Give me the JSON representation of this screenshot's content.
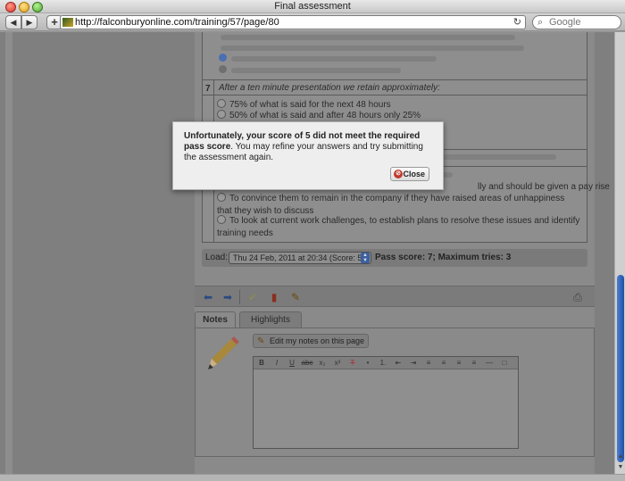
{
  "window": {
    "title": "Final assessment"
  },
  "toolbar": {
    "back_icon": "back-arrow-icon",
    "forward_icon": "forward-arrow-icon",
    "add_label": "+",
    "url": "http://falconburyonline.com/training/57/page/80",
    "reload_icon": "reload-icon",
    "search_placeholder": "Google"
  },
  "questions": {
    "q7": {
      "number": "7",
      "text": "After a ten minute presentation we retain approximately:",
      "options": [
        "75% of what is said for the next 48 hours",
        "50% of what is said and after 48 hours only 25%"
      ]
    },
    "q8": {
      "options": [
        "lly and should be given a pay rise",
        "To convince them to remain in the company if they have raised areas of unhappiness that they wish to discuss",
        "To look at current work challenges, to establish plans to resolve these issues and identify training needs"
      ]
    }
  },
  "load": {
    "label": "Load:",
    "selected": "Thu 24 Feb, 2011 at 20:34 (Score: 5)",
    "info": "Pass score: 7; Maximum tries: 3"
  },
  "tabs": {
    "notes": "Notes",
    "highlights": "Highlights"
  },
  "notes": {
    "edit_label": "Edit my notes on this page",
    "editor_buttons": [
      "B",
      "I",
      "U",
      "abc",
      "x₂",
      "x²",
      "T",
      "•",
      "1.",
      "⇤",
      "⇥",
      "≡",
      "≡",
      "≡",
      "≡",
      "—",
      "□"
    ]
  },
  "dialog": {
    "message_bold": "Unfortunately, your score of 5 did not meet the required pass score",
    "message_rest": ". You may refine your answers and try submitting the assessment again.",
    "close_label": "Close"
  },
  "colors": {
    "accent": "#1f4fa4",
    "dialog_bg": "#eeeeee",
    "overlay": "#7f7f7f"
  }
}
